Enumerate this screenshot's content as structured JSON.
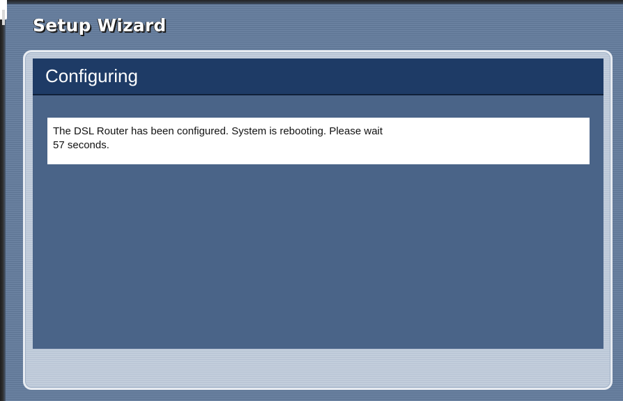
{
  "wizard": {
    "title": "Setup Wizard"
  },
  "panel": {
    "heading": "Configuring",
    "message_line1": "The DSL Router has been configured. System is rebooting. Please wait",
    "message_line2": "57 seconds."
  },
  "colors": {
    "header_bar": "#1e3b66",
    "content_background": "#4a6488",
    "outer_stripes": "#6a81a0",
    "footer_stripes": "#c3cedc",
    "message_background": "#ffffff"
  }
}
